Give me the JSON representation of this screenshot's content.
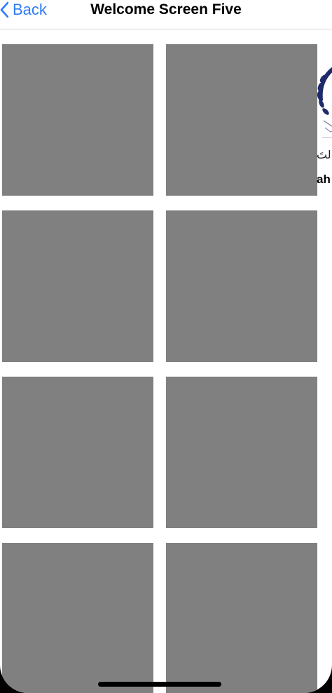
{
  "nav": {
    "back_label": "Back",
    "title": "Welcome Screen Five"
  },
  "grid": {
    "tiles": [
      {
        "label": ""
      },
      {
        "label": ""
      },
      {
        "label": ""
      },
      {
        "label": ""
      },
      {
        "label": ""
      },
      {
        "label": ""
      },
      {
        "label": ""
      },
      {
        "label": ""
      }
    ]
  },
  "side_peek": {
    "arabic_text": "زالتَ",
    "latin_text": "ah P"
  },
  "colors": {
    "accent": "#2f7cf6",
    "tile": "#808080",
    "background": "#ffffff",
    "logo": "#1f2a6b"
  },
  "icons": {
    "back": "chevron-left-icon",
    "logo": "laurel-emblem-icon"
  }
}
